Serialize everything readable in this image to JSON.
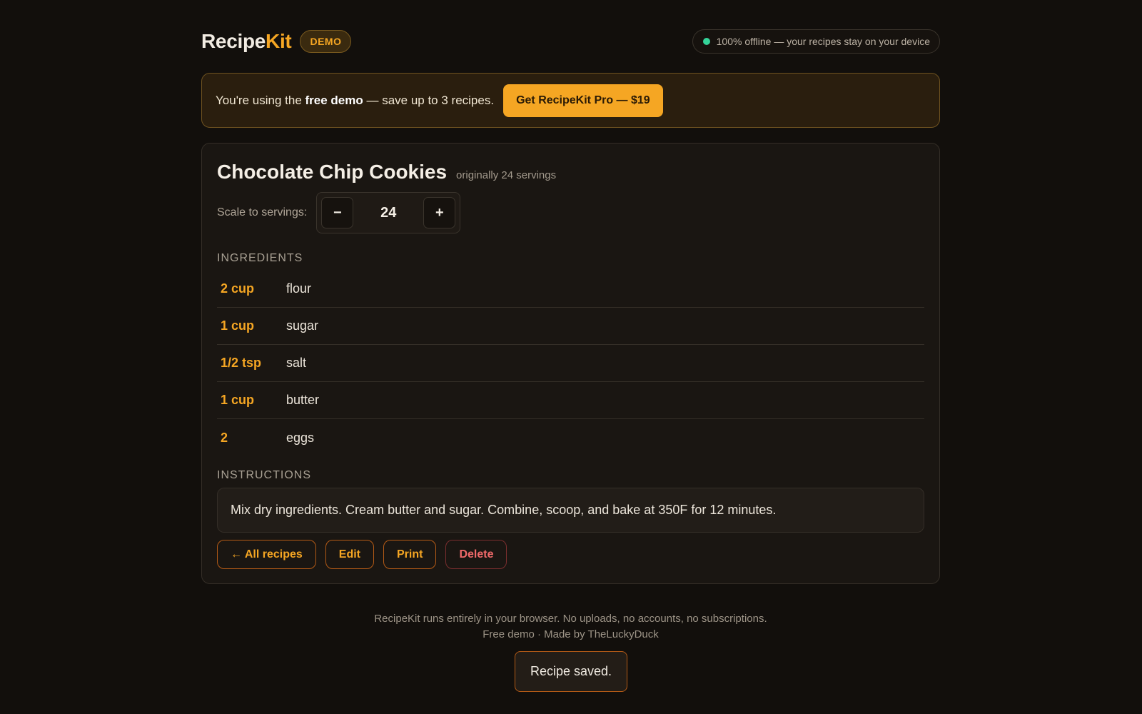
{
  "header": {
    "logo_part1": "Recipe",
    "logo_part2": "Kit",
    "badge": "DEMO",
    "offline_text": "100% offline — your recipes stay on your device"
  },
  "banner": {
    "text_prefix": "You're using the ",
    "text_bold": "free demo",
    "text_suffix": " — save up to 3 recipes.",
    "cta_label": "Get RecipeKit Pro — $19"
  },
  "recipe": {
    "title": "Chocolate Chip Cookies",
    "original_servings": "originally 24 servings",
    "scale_label": "Scale to servings:",
    "decrement_label": "−",
    "servings": "24",
    "increment_label": "+",
    "ingredients_label": "INGREDIENTS",
    "ingredients": [
      {
        "qty": "2 cup",
        "name": "flour"
      },
      {
        "qty": "1 cup",
        "name": "sugar"
      },
      {
        "qty": "1/2 tsp",
        "name": "salt"
      },
      {
        "qty": "1 cup",
        "name": "butter"
      },
      {
        "qty": "2",
        "name": "eggs"
      }
    ],
    "instructions_label": "INSTRUCTIONS",
    "instructions": "Mix dry ingredients. Cream butter and sugar. Combine, scoop, and bake at 350F for 12 minutes."
  },
  "actions": {
    "all_recipes": "← All recipes",
    "edit": "Edit",
    "print": "Print",
    "delete": "Delete"
  },
  "footer": {
    "line1": "RecipeKit runs entirely in your browser. No uploads, no accounts, no subscriptions.",
    "line2": "Free demo · Made by TheLuckyDuck"
  },
  "toast": {
    "message": "Recipe saved."
  },
  "colors": {
    "accent": "#f5a623",
    "background": "#120f0c",
    "danger": "#f06a6a",
    "online": "#34d399"
  }
}
